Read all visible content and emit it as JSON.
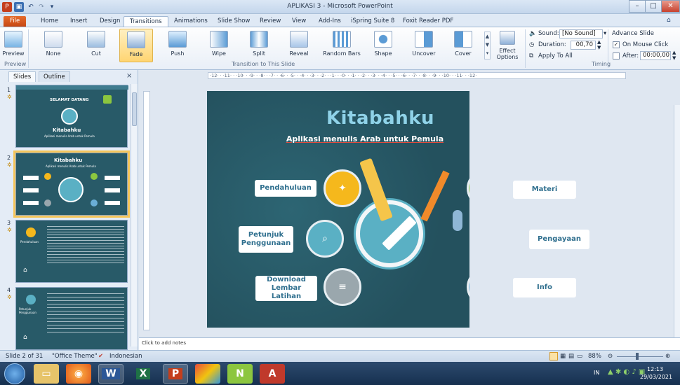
{
  "window": {
    "title": "APLIKASI 3 - Microsoft PowerPoint",
    "minimize": "–",
    "restore": "□",
    "close": "✕"
  },
  "ribbon_tabs": [
    "File",
    "Home",
    "Insert",
    "Design",
    "Transitions",
    "Animations",
    "Slide Show",
    "Review",
    "View",
    "Add-Ins",
    "iSpring Suite 8",
    "Foxit Reader PDF"
  ],
  "active_tab": "Transitions",
  "ribbon": {
    "preview_label": "Preview",
    "preview_group": "Preview",
    "transitions": [
      "None",
      "Cut",
      "Fade",
      "Push",
      "Wipe",
      "Split",
      "Reveal",
      "Random Bars",
      "Shape",
      "Uncover",
      "Cover"
    ],
    "selected_transition": "Fade",
    "effect_options": "Effect Options",
    "transition_group": "Transition to This Slide",
    "sound_label": "Sound:",
    "sound_value": "[No Sound]",
    "duration_label": "Duration:",
    "duration_value": "00,70",
    "apply_all": "Apply To All",
    "advance_slide": "Advance Slide",
    "on_mouse_click": "On Mouse Click",
    "on_mouse_click_checked": true,
    "after_label": "After:",
    "after_value": "00:00,00",
    "timing_group": "Timing"
  },
  "left_pane": {
    "tabs": [
      "Slides",
      "Outline"
    ],
    "close": "×",
    "thumbs": [
      {
        "num": "1",
        "title": "Kitabahku",
        "subtitle": "Aplikasi menulis Arab untuk Pemula",
        "greeting": "SELAMAT DATANG"
      },
      {
        "num": "2",
        "title": "Kitabahku",
        "subtitle": "Aplikasi menulis Arab untuk Pemula"
      },
      {
        "num": "3",
        "title": "Pendahuluan"
      },
      {
        "num": "4",
        "title": "Petunjuk Penggunaan"
      }
    ]
  },
  "ruler_text": "·12· · ·11· · ·10· · ·9· · ·8· · ·7· · ·6· · ·5· · ·4· · ·3· · ·2· · ·1· · ·0· · ·1· · ·2· · ·3· · ·4· · ·5· · ·6· · ·7· · ·8· · ·9· · ·10· · ·11· · ·12·",
  "slide": {
    "title": "Kitabahku",
    "subtitle": "Aplikasi menulis Arab untuk Pemula",
    "buttons": {
      "pendahuluan": "Pendahuluan",
      "petunjuk": "Petunjuk Penggunaan",
      "download": "Download Lembar Latihan",
      "materi": "Materi",
      "pengayaan": "Pengayaan",
      "info": "Info"
    },
    "colors": {
      "bg": "#24515e",
      "yellow": "#f5b81c",
      "teal": "#5ab0c4",
      "green": "#8cc63f",
      "orange": "#f29d3e",
      "blue": "#6aaed6",
      "gray": "#9aa7ad"
    }
  },
  "notes_placeholder": "Click to add notes",
  "status": {
    "slide_info": "Slide 2 of 31",
    "theme": "\"Office Theme\"",
    "language": "Indonesian",
    "zoom": "88%"
  },
  "taskbar": {
    "lang": "IN",
    "time": "12:13",
    "date": "29/03/2021",
    "apps": [
      "start",
      "explorer",
      "firefox",
      "word",
      "excel",
      "powerpoint",
      "media",
      "app7",
      "acrobat"
    ]
  }
}
